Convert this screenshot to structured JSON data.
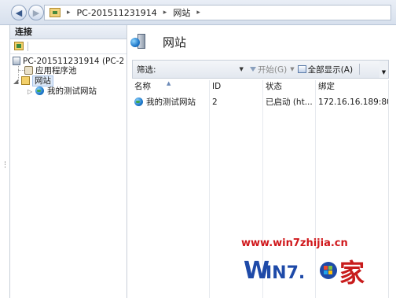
{
  "window": {
    "breadcrumb": [
      "PC-201511231914",
      "网站"
    ],
    "nav": {
      "back_icon": "back-arrow-icon",
      "forward_icon": "forward-arrow-icon"
    }
  },
  "connections": {
    "header": "连接",
    "tree": {
      "server": "PC-201511231914 (PC-2",
      "app_pools": "应用程序池",
      "sites": "网站",
      "site": "我的测试网站"
    }
  },
  "page": {
    "title": "网站"
  },
  "filter_bar": {
    "label": "筛选:",
    "value": "",
    "start": "开始(G)",
    "show_all": "全部显示(A)"
  },
  "sites_table": {
    "columns": [
      "名称",
      "ID",
      "状态",
      "绑定"
    ],
    "rows": [
      {
        "name": "我的测试网站",
        "id": "2",
        "status": "已启动 (ht...",
        "binding": "172.16.16.189:80"
      }
    ]
  },
  "watermark": {
    "url": "www.win7zhijia.cn",
    "logo_text": "WIN7家"
  },
  "colors": {
    "accent": "#1f78c9",
    "watermark_red": "#d0181c",
    "watermark_blue": "#1e4aa8"
  }
}
